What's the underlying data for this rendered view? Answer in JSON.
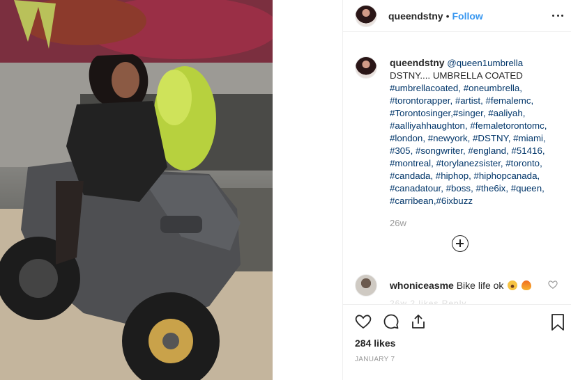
{
  "post": {
    "username": "queendstny",
    "separator": "•",
    "follow_label": "Follow",
    "more_icon": "more-horizontal-icon"
  },
  "caption": {
    "username": "queendstny",
    "mention": "@queen1umbrella",
    "text": "DSTNY.... UMBRELLA COATED",
    "hashtags": "#umbrellacoated, #oneumbrella, #torontorapper, #artist, #femalemc, #Torontosinger,#singer, #aaliyah, #aalliyahhaughton, #femaletorontomc, #london, #newyork, #DSTNY,  #miami, #305, #songwriter, #england, #51416, #montreal, #torylanezsister, #toronto, #candada, #hiphop, #hiphopcanada, #canadatour, #boss, #the6ix, #queen, #carribean,#6ixbuzz",
    "time": "26w"
  },
  "comment": {
    "username": "whoniceasme",
    "text": "Bike life ok",
    "emojis": [
      "laughing-face-emoji",
      "fire-emoji"
    ],
    "faded_preview": "26w  2 likes  Reply"
  },
  "footer": {
    "likes": "284 likes",
    "date": "JANUARY 7"
  },
  "colors": {
    "link": "#3897f0",
    "hashtag": "#003569",
    "muted": "#999999",
    "text": "#262626"
  }
}
